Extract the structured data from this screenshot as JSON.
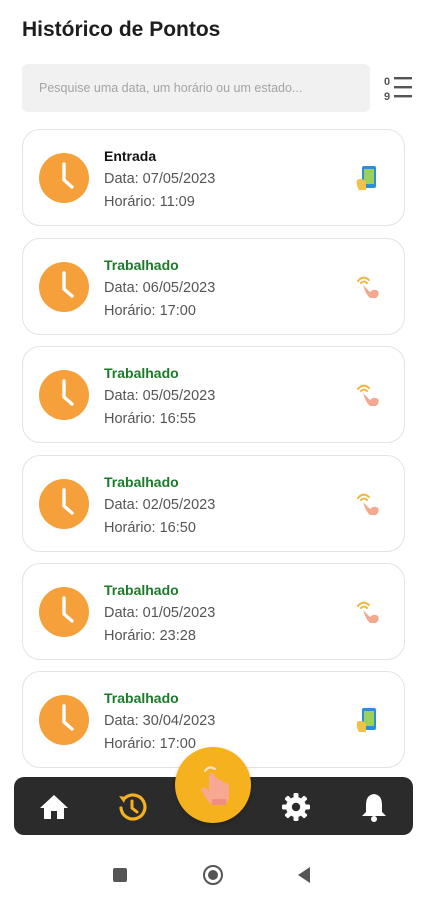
{
  "header": {
    "title": "Histórico de Pontos"
  },
  "search": {
    "placeholder": "Pesquise uma data, um horário ou um estado...",
    "value": ""
  },
  "filter_icon": "sort-numeric-list-icon",
  "records": [
    {
      "status": "Entrada",
      "date": "Data: 07/05/2023",
      "time": "Horário: 11:09",
      "status_color": "#111111",
      "type_icon": "phone-checkin-icon"
    },
    {
      "status": "Trabalhado",
      "date": "Data: 06/05/2023",
      "time": "Horário: 17:00",
      "status_color": "#1c7a2a",
      "type_icon": "tap-hand-icon"
    },
    {
      "status": "Trabalhado",
      "date": "Data: 05/05/2023",
      "time": "Horário: 16:55",
      "status_color": "#1c7a2a",
      "type_icon": "tap-hand-icon"
    },
    {
      "status": "Trabalhado",
      "date": "Data: 02/05/2023",
      "time": "Horário: 16:50",
      "status_color": "#1c7a2a",
      "type_icon": "tap-hand-icon"
    },
    {
      "status": "Trabalhado",
      "date": "Data: 01/05/2023",
      "time": "Horário: 23:28",
      "status_color": "#1c7a2a",
      "type_icon": "tap-hand-icon"
    },
    {
      "status": "Trabalhado",
      "date": "Data: 30/04/2023",
      "time": "Horário: 17:00",
      "status_color": "#1c7a2a",
      "type_icon": "phone-checkin-icon"
    }
  ],
  "bottom_nav": {
    "items": [
      "home-icon",
      "history-icon",
      "settings-icon",
      "bell-icon"
    ],
    "active": "history-icon",
    "fab_icon": "tap-hand-icon"
  },
  "colors": {
    "accent": "#f5b21e",
    "clock": "#f5a03b",
    "nav_bg": "#2b2b2b",
    "worked": "#1c7a2a"
  }
}
